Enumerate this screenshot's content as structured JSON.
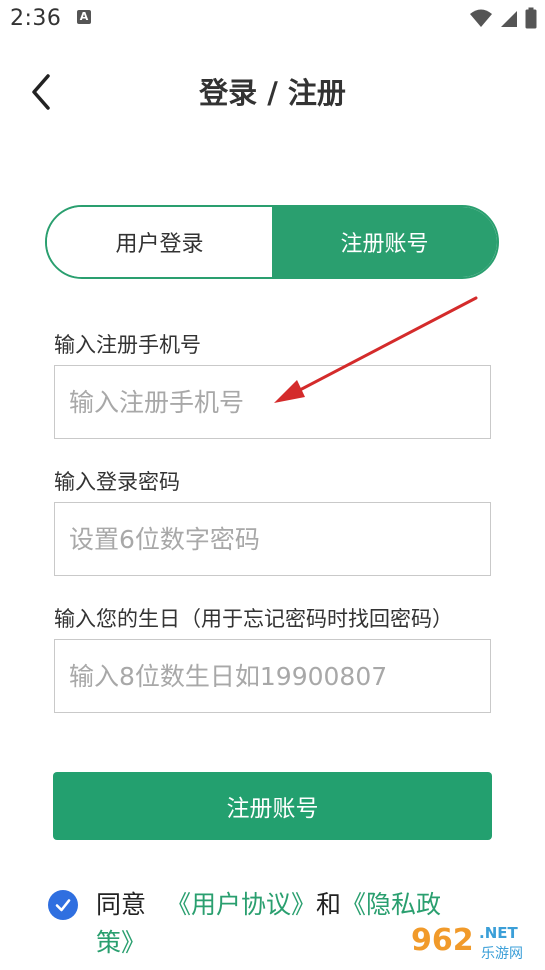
{
  "status_bar": {
    "time": "2:36",
    "app_badge": "A",
    "icons": [
      "wifi-icon",
      "signal-icon",
      "battery-icon"
    ]
  },
  "header": {
    "title": "登录 / 注册",
    "back_icon": "chevron-left-icon"
  },
  "tabs": [
    {
      "label": "用户登录",
      "active": false
    },
    {
      "label": "注册账号",
      "active": true
    }
  ],
  "form": {
    "phone": {
      "label": "输入注册手机号",
      "placeholder": "输入注册手机号",
      "value": ""
    },
    "password": {
      "label": "输入登录密码",
      "placeholder": "设置6位数字密码",
      "value": ""
    },
    "birthday": {
      "label": "输入您的生日（用于忘记密码时找回密码）",
      "placeholder": "输入8位数生日如19900807",
      "value": ""
    },
    "submit_label": "注册账号"
  },
  "agreement": {
    "checked": true,
    "prefix": "同意",
    "user_agreement": "《用户协议》",
    "conjunction": "和",
    "privacy_policy": "《隐私政策》"
  },
  "watermark": {
    "brand": "962.NET",
    "sub": "乐游网"
  },
  "colors": {
    "accent_green": "#2a9f6f",
    "checkbox_blue": "#2f6fe0",
    "annotation_red": "#d42b2b"
  }
}
